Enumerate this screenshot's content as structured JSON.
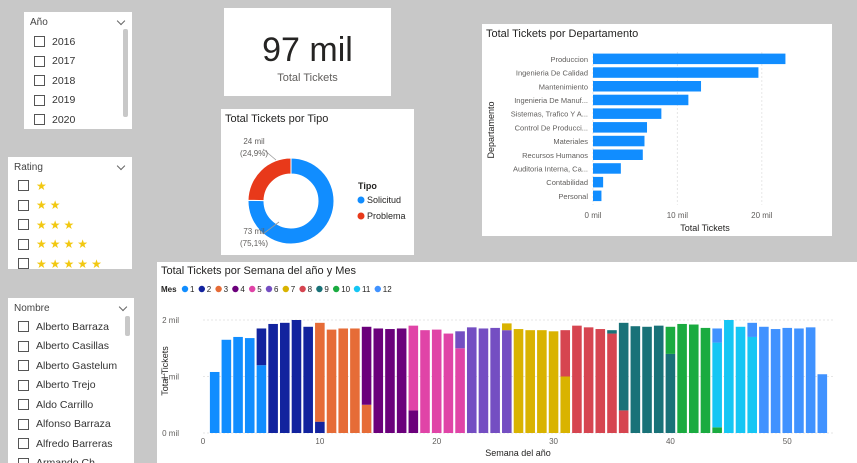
{
  "year_slicer": {
    "title": "Año",
    "items": [
      "2016",
      "2017",
      "2018",
      "2019",
      "2020"
    ]
  },
  "kpi": {
    "value": "97 mil",
    "label": "Total Tickets"
  },
  "rating_slicer": {
    "title": "Rating",
    "star_icon": "star-icon",
    "levels": [
      1,
      2,
      3,
      4,
      5
    ],
    "star_color": "#f2c811"
  },
  "name_slicer": {
    "title": "Nombre",
    "items": [
      "Alberto Barraza",
      "Alberto Casillas",
      "Alberto Gastelum",
      "Alberto Trejo",
      "Aldo Carrillo",
      "Alfonso Barraza",
      "Alfredo Barreras",
      "Armando Ch..."
    ]
  },
  "chart_data": [
    {
      "type": "pie",
      "variant": "donut",
      "title": "Total Tickets por Tipo",
      "legend_title": "Tipo",
      "legend_position": "right",
      "slices": [
        {
          "name": "Solicitud",
          "value": 73000,
          "label_value": "73 mil",
          "label_pct": "(75,1%)",
          "color": "#118dff"
        },
        {
          "name": "Problema",
          "value": 24000,
          "label_value": "24 mil",
          "label_pct": "(24,9%)",
          "color": "#e8391a"
        }
      ]
    },
    {
      "type": "bar",
      "orientation": "horizontal",
      "title": "Total Tickets por Departamento",
      "xlabel": "Total Tickets",
      "ylabel": "Departamento",
      "xlim": [
        0,
        25000
      ],
      "xticks": [
        "0 mil",
        "10 mil",
        "20 mil"
      ],
      "xtick_values": [
        0,
        10000,
        20000
      ],
      "grid": true,
      "color": "#118dff",
      "categories": [
        "Produccion",
        "Ingenieria De Calidad",
        "Mantenimiento",
        "Ingenieria De Manuf...",
        "Sistemas, Trafico Y A...",
        "Control De Producci...",
        "Materiales",
        "Recursos Humanos",
        "Auditoria Interna, Ca...",
        "Contabilidad",
        "Personal"
      ],
      "values": [
        22800,
        19600,
        12800,
        11300,
        8100,
        6400,
        6100,
        5900,
        3300,
        1200,
        1000
      ]
    },
    {
      "type": "bar",
      "variant": "stacked-column",
      "title": "Total Tickets por Semana del año y Mes",
      "legend_title": "Mes",
      "legend_position": "top-left",
      "xlabel": "Semana del año",
      "ylabel": "Total Tickets",
      "ylim": [
        0,
        2000
      ],
      "yticks": [
        "0 mil",
        "1 mil",
        "2 mil"
      ],
      "ytick_values": [
        0,
        1000,
        2000
      ],
      "xticks": [
        0,
        10,
        20,
        30,
        40,
        50
      ],
      "xlim": [
        0,
        54
      ],
      "grid": true,
      "months": [
        {
          "name": "1",
          "color": "#118dff"
        },
        {
          "name": "2",
          "color": "#12239e"
        },
        {
          "name": "3",
          "color": "#e66c37"
        },
        {
          "name": "4",
          "color": "#6b007b"
        },
        {
          "name": "5",
          "color": "#e044a7"
        },
        {
          "name": "6",
          "color": "#744ec2"
        },
        {
          "name": "7",
          "color": "#d9b300"
        },
        {
          "name": "8",
          "color": "#d64550"
        },
        {
          "name": "9",
          "color": "#197278"
        },
        {
          "name": "10",
          "color": "#1aab40"
        },
        {
          "name": "11",
          "color": "#15c6f4"
        },
        {
          "name": "12",
          "color": "#4092ff"
        }
      ],
      "weeks": [
        {
          "week": 1,
          "stack": [
            [
              1,
              1080
            ]
          ]
        },
        {
          "week": 2,
          "stack": [
            [
              1,
              1650
            ]
          ]
        },
        {
          "week": 3,
          "stack": [
            [
              1,
              1700
            ]
          ]
        },
        {
          "week": 4,
          "stack": [
            [
              1,
              1680
            ]
          ]
        },
        {
          "week": 5,
          "stack": [
            [
              1,
              1200
            ],
            [
              2,
              650
            ]
          ]
        },
        {
          "week": 6,
          "stack": [
            [
              2,
              1930
            ]
          ]
        },
        {
          "week": 7,
          "stack": [
            [
              2,
              1950
            ]
          ]
        },
        {
          "week": 8,
          "stack": [
            [
              2,
              2000
            ]
          ]
        },
        {
          "week": 9,
          "stack": [
            [
              2,
              1880
            ]
          ]
        },
        {
          "week": 10,
          "stack": [
            [
              2,
              200
            ],
            [
              3,
              1750
            ]
          ]
        },
        {
          "week": 11,
          "stack": [
            [
              3,
              1830
            ]
          ]
        },
        {
          "week": 12,
          "stack": [
            [
              3,
              1850
            ]
          ]
        },
        {
          "week": 13,
          "stack": [
            [
              3,
              1850
            ]
          ]
        },
        {
          "week": 14,
          "stack": [
            [
              3,
              500
            ],
            [
              4,
              1380
            ]
          ]
        },
        {
          "week": 15,
          "stack": [
            [
              4,
              1850
            ]
          ]
        },
        {
          "week": 16,
          "stack": [
            [
              4,
              1840
            ]
          ]
        },
        {
          "week": 17,
          "stack": [
            [
              4,
              1850
            ]
          ]
        },
        {
          "week": 18,
          "stack": [
            [
              4,
              400
            ],
            [
              5,
              1500
            ]
          ]
        },
        {
          "week": 19,
          "stack": [
            [
              5,
              1820
            ]
          ]
        },
        {
          "week": 20,
          "stack": [
            [
              5,
              1830
            ]
          ]
        },
        {
          "week": 21,
          "stack": [
            [
              5,
              1760
            ]
          ]
        },
        {
          "week": 22,
          "stack": [
            [
              5,
              1500
            ],
            [
              6,
              300
            ]
          ]
        },
        {
          "week": 23,
          "stack": [
            [
              6,
              1870
            ]
          ]
        },
        {
          "week": 24,
          "stack": [
            [
              6,
              1850
            ]
          ]
        },
        {
          "week": 25,
          "stack": [
            [
              6,
              1860
            ]
          ]
        },
        {
          "week": 26,
          "stack": [
            [
              6,
              1820
            ],
            [
              7,
              120
            ]
          ]
        },
        {
          "week": 27,
          "stack": [
            [
              7,
              1840
            ]
          ]
        },
        {
          "week": 28,
          "stack": [
            [
              7,
              1820
            ]
          ]
        },
        {
          "week": 29,
          "stack": [
            [
              7,
              1820
            ]
          ]
        },
        {
          "week": 30,
          "stack": [
            [
              7,
              1800
            ]
          ]
        },
        {
          "week": 31,
          "stack": [
            [
              7,
              1000
            ],
            [
              8,
              820
            ]
          ]
        },
        {
          "week": 32,
          "stack": [
            [
              8,
              1900
            ]
          ]
        },
        {
          "week": 33,
          "stack": [
            [
              8,
              1870
            ]
          ]
        },
        {
          "week": 34,
          "stack": [
            [
              8,
              1840
            ]
          ]
        },
        {
          "week": 35,
          "stack": [
            [
              8,
              1760
            ],
            [
              9,
              60
            ]
          ]
        },
        {
          "week": 36,
          "stack": [
            [
              8,
              400
            ],
            [
              9,
              1550
            ]
          ]
        },
        {
          "week": 37,
          "stack": [
            [
              9,
              1890
            ]
          ]
        },
        {
          "week": 38,
          "stack": [
            [
              9,
              1880
            ]
          ]
        },
        {
          "week": 39,
          "stack": [
            [
              9,
              1900
            ]
          ]
        },
        {
          "week": 40,
          "stack": [
            [
              9,
              1400
            ],
            [
              10,
              480
            ]
          ]
        },
        {
          "week": 41,
          "stack": [
            [
              10,
              1930
            ]
          ]
        },
        {
          "week": 42,
          "stack": [
            [
              10,
              1920
            ]
          ]
        },
        {
          "week": 43,
          "stack": [
            [
              10,
              1860
            ]
          ]
        },
        {
          "week": 44,
          "stack": [
            [
              10,
              100
            ],
            [
              11,
              1500
            ],
            [
              12,
              250
            ]
          ]
        },
        {
          "week": 45,
          "stack": [
            [
              11,
              2000
            ]
          ]
        },
        {
          "week": 46,
          "stack": [
            [
              11,
              1880
            ]
          ]
        },
        {
          "week": 47,
          "stack": [
            [
              11,
              1700
            ],
            [
              12,
              250
            ]
          ]
        },
        {
          "week": 48,
          "stack": [
            [
              12,
              1880
            ]
          ]
        },
        {
          "week": 49,
          "stack": [
            [
              12,
              1840
            ]
          ]
        },
        {
          "week": 50,
          "stack": [
            [
              12,
              1860
            ]
          ]
        },
        {
          "week": 51,
          "stack": [
            [
              12,
              1850
            ]
          ]
        },
        {
          "week": 52,
          "stack": [
            [
              12,
              1870
            ]
          ]
        },
        {
          "week": 53,
          "stack": [
            [
              12,
              1040
            ]
          ]
        }
      ]
    }
  ]
}
